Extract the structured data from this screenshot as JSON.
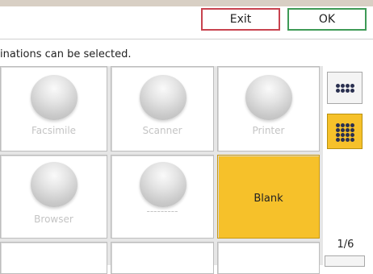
{
  "toolbar": {
    "exit_label": "Exit",
    "ok_label": "OK"
  },
  "message": "inations can be selected.",
  "tiles": [
    {
      "label": "Facsimile",
      "icon": "sphere-icon",
      "enabled": false
    },
    {
      "label": "Scanner",
      "icon": "sphere-icon",
      "enabled": false
    },
    {
      "label": "Printer",
      "icon": "sphere-icon",
      "enabled": false
    },
    {
      "label": "Browser",
      "icon": "sphere-icon",
      "enabled": false
    },
    {
      "label": "---------",
      "icon": "sphere-icon",
      "enabled": false
    },
    {
      "label": "Blank",
      "selected": true
    }
  ],
  "view_options": [
    {
      "icon": "small-grid-icon",
      "selected": false
    },
    {
      "icon": "large-grid-icon",
      "selected": true
    }
  ],
  "pager": {
    "label": "1/6"
  },
  "colors": {
    "accent_yellow": "#f6c12a",
    "exit_border": "#c8434f",
    "ok_border": "#3e9a56"
  }
}
